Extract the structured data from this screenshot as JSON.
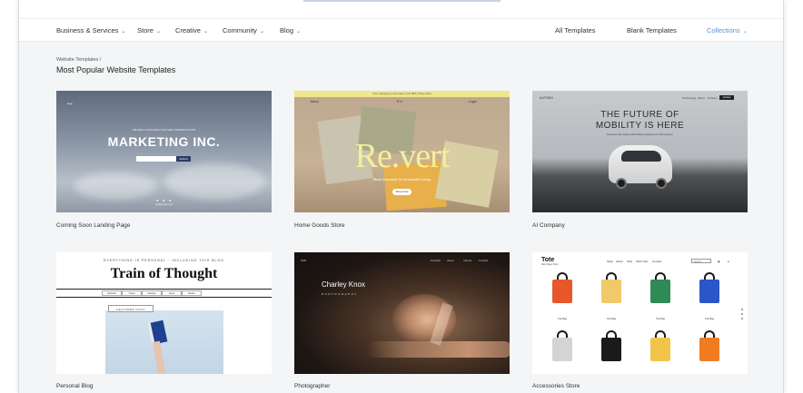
{
  "nav": {
    "left": [
      {
        "label": "Business & Services",
        "chevron": "⌄"
      },
      {
        "label": "Store",
        "chevron": "⌄"
      },
      {
        "label": "Creative",
        "chevron": "⌄"
      },
      {
        "label": "Community",
        "chevron": "⌄"
      },
      {
        "label": "Blog",
        "chevron": "⌄"
      }
    ],
    "right": [
      {
        "label": "All Templates"
      },
      {
        "label": "Blank Templates"
      },
      {
        "label": "Collections",
        "chevron": "⌄"
      }
    ],
    "collections_color": "#5b8fd9"
  },
  "breadcrumb": "Website Templates /",
  "page_title": "Most Popular Website Templates",
  "templates": [
    {
      "label": "Coming Soon Landing Page",
      "thumb": {
        "headline": "MARKETING INC.",
        "tagline": "WE ARE LAUNCHING OUR NEW WEBSITE SOON",
        "logo": "logo",
        "button": "Submit",
        "footer": "info@mysite.com"
      }
    },
    {
      "label": "Home Goods Store",
      "thumb": {
        "promo_bar": "Free shipping on all orders over $50 | Shop Now",
        "menu_left": "Menu",
        "logo": "R.V",
        "menu_right": "Login",
        "headline": "Re.vert",
        "tagline": "Home Essentials for Sustainable Living",
        "button": "Shop Now",
        "accent_color": "#f5ef9a"
      }
    },
    {
      "label": "AI Company",
      "thumb": {
        "brand": "AUTONO",
        "menu": [
          "Technology",
          "About",
          "Careers"
        ],
        "cta": "Contact",
        "headline_line1": "THE FUTURE OF",
        "headline_line2": "MOBILITY IS HERE",
        "tagline": "Discover the safest self-driving experience with Autono"
      }
    },
    {
      "label": "Personal Blog",
      "thumb": {
        "kicker": "EVERYTHING IS PERSONAL · INCLUDING THIS BLOG",
        "headline": "Train of Thought",
        "tabs": [
          "All Posts",
          "Travel",
          "Lifestyle",
          "Food",
          "Books"
        ],
        "featured": "FEATURED POST"
      }
    },
    {
      "label": "Photographer",
      "thumb": {
        "logo": "CKP",
        "menu": [
          "Portfolio",
          "About",
          "Clients",
          "Contact"
        ],
        "headline": "Charley Knox",
        "tagline": "PHOTOGRAPHY"
      }
    },
    {
      "label": "Accessories Store",
      "thumb": {
        "brand": "Tote",
        "brand_sub": "Daily Bags Shop",
        "menu": [
          "Shop",
          "About",
          "FAQ",
          "Wish Tote",
          "Contact"
        ],
        "search": "Search",
        "product_caption": "Tote Bag",
        "bag_colors": [
          "#e8572a",
          "#f0c96a",
          "#2f8a55",
          "#2a56c8",
          "#d4d4d4",
          "#1a1a1a",
          "#f2c54a",
          "#f07c22"
        ]
      }
    }
  ]
}
